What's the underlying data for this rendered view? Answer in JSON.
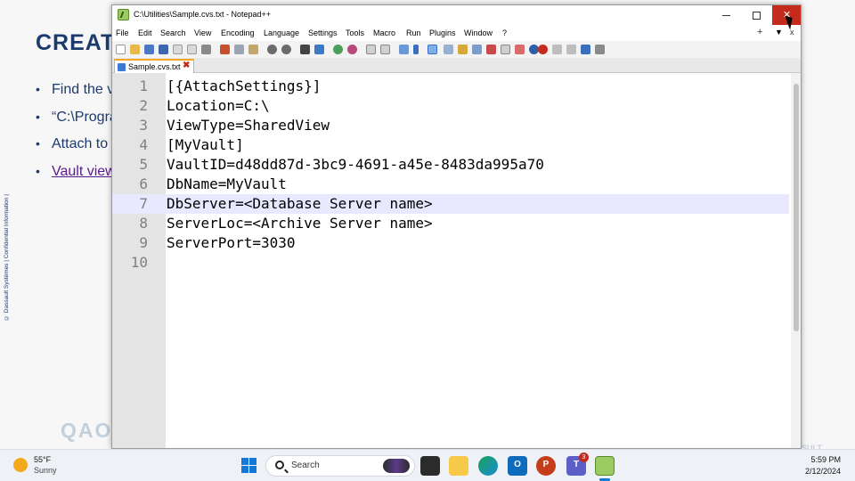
{
  "slide": {
    "title": "CREAT",
    "bullets": [
      {
        "text": "Find the v",
        "link": false
      },
      {
        "text": "“C:\\Progra",
        "link": false
      },
      {
        "text": "Attach to",
        "link": false
      },
      {
        "text": "Vault view",
        "link": true
      }
    ],
    "side_note": "© Dassault Systèmes | Confidential Information |",
    "logo_text": "QAO",
    "right_mark": "SULT"
  },
  "window": {
    "title": "C:\\Utilities\\Sample.cvs.txt - Notepad++",
    "menu": [
      "File",
      "Edit",
      "Search",
      "View",
      "Encoding",
      "Language",
      "Settings",
      "Tools",
      "Macro",
      "Run",
      "Plugins",
      "Window",
      "?"
    ],
    "menu_plus": "+",
    "menu_down": "▼",
    "menu_close": "x"
  },
  "tab": {
    "label": "Sample.cvs.txt",
    "close": "✖"
  },
  "editor": {
    "current_line": 7,
    "lines": [
      "[{AttachSettings}]",
      "Location=C:\\",
      "ViewType=SharedView",
      "[MyVault]",
      "VaultID=d48dd87d-3bc9-4691-a45e-8483da995a70",
      "DbName=MyVault",
      "DbServer=<Database Server name>",
      "ServerLoc=<Archive Server name>",
      "ServerPort=3030",
      ""
    ]
  },
  "taskbar": {
    "weather": {
      "temp": "55°F",
      "desc": "Sunny"
    },
    "search_label": "Search",
    "teams_badge": "3",
    "time": "5:59 PM",
    "date": "2/12/2024"
  },
  "colors": {
    "accent": "#1479d6",
    "close_button": "#c42b1c",
    "current_line": "#e8e8ff",
    "slide_text": "#1c3a6e"
  }
}
